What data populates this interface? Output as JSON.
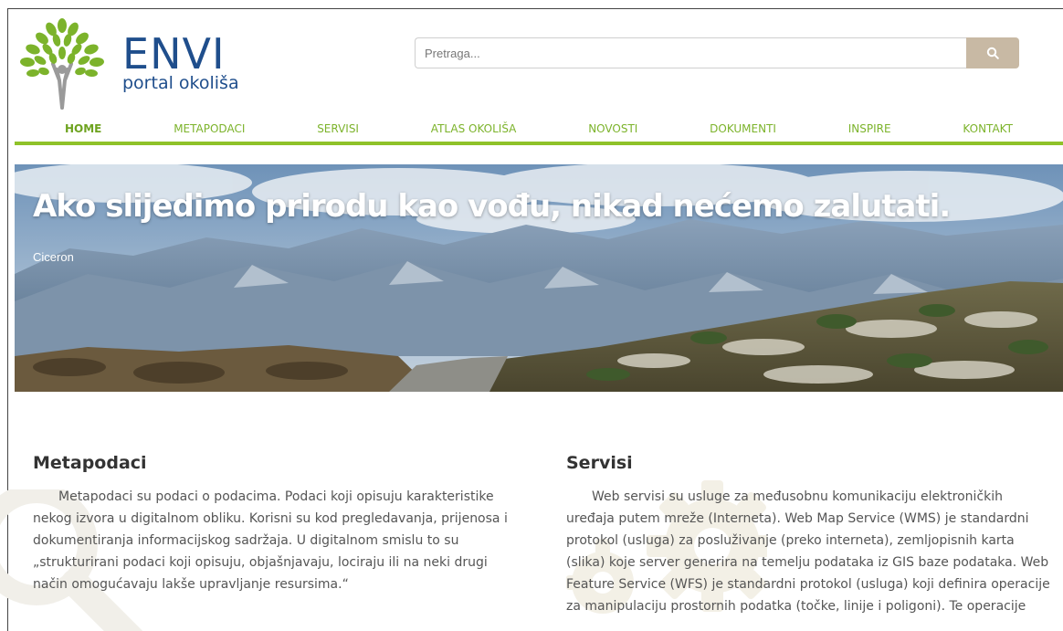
{
  "header": {
    "logo_title": "ENVI",
    "logo_subtitle": "portal okoliša",
    "search_placeholder": "Pretraga...",
    "search_icon": "search-icon"
  },
  "nav": {
    "items": [
      {
        "label": "HOME",
        "active": true
      },
      {
        "label": "METAPODACI",
        "active": false
      },
      {
        "label": "SERVISI",
        "active": false
      },
      {
        "label": "ATLAS OKOLIŠA",
        "active": false
      },
      {
        "label": "NOVOSTI",
        "active": false
      },
      {
        "label": "DOKUMENTI",
        "active": false
      },
      {
        "label": "INSPIRE",
        "active": false
      },
      {
        "label": "KONTAKT",
        "active": false
      }
    ]
  },
  "hero": {
    "quote": "Ako slijedimo prirodu kao vođu, nikad nećemo zalutati.",
    "author": "Ciceron"
  },
  "sections": {
    "metapodaci": {
      "title": "Metapodaci",
      "text": "Metapodaci su podaci o podacima. Podaci koji opisuju karakteristike nekog izvora u digitalnom obliku. Korisni su kod pregledavanja, prijenosa i dokumentiranja informacijskog sadržaja. U digitalnom smislu to su „strukturirani podaci koji opisuju, objašnjavaju, lociraju ili na neki drugi način omogućavaju lakše upravljanje resursima.“",
      "icon": "magnifier-icon"
    },
    "servisi": {
      "title": "Servisi",
      "text": "Web servisi su usluge za međusobnu komunikaciju elektroničkih uređaja putem mreže (Interneta). Web Map Service (WMS) je standardni protokol (usluga) za posluživanje (preko interneta), zemljopisnih karta (slika) koje server generira na temelju podataka iz GIS baze podataka. Web Feature Service (WFS) je standardni protokol (usluga) koji definira operacije za manipulaciju prostornih podatka (točke, linije i poligoni). Te operacije",
      "icon": "gear-icon"
    }
  },
  "colors": {
    "brand_blue": "#1f4e8c",
    "nav_green": "#7cb32b",
    "search_button": "#c8b9a4"
  }
}
